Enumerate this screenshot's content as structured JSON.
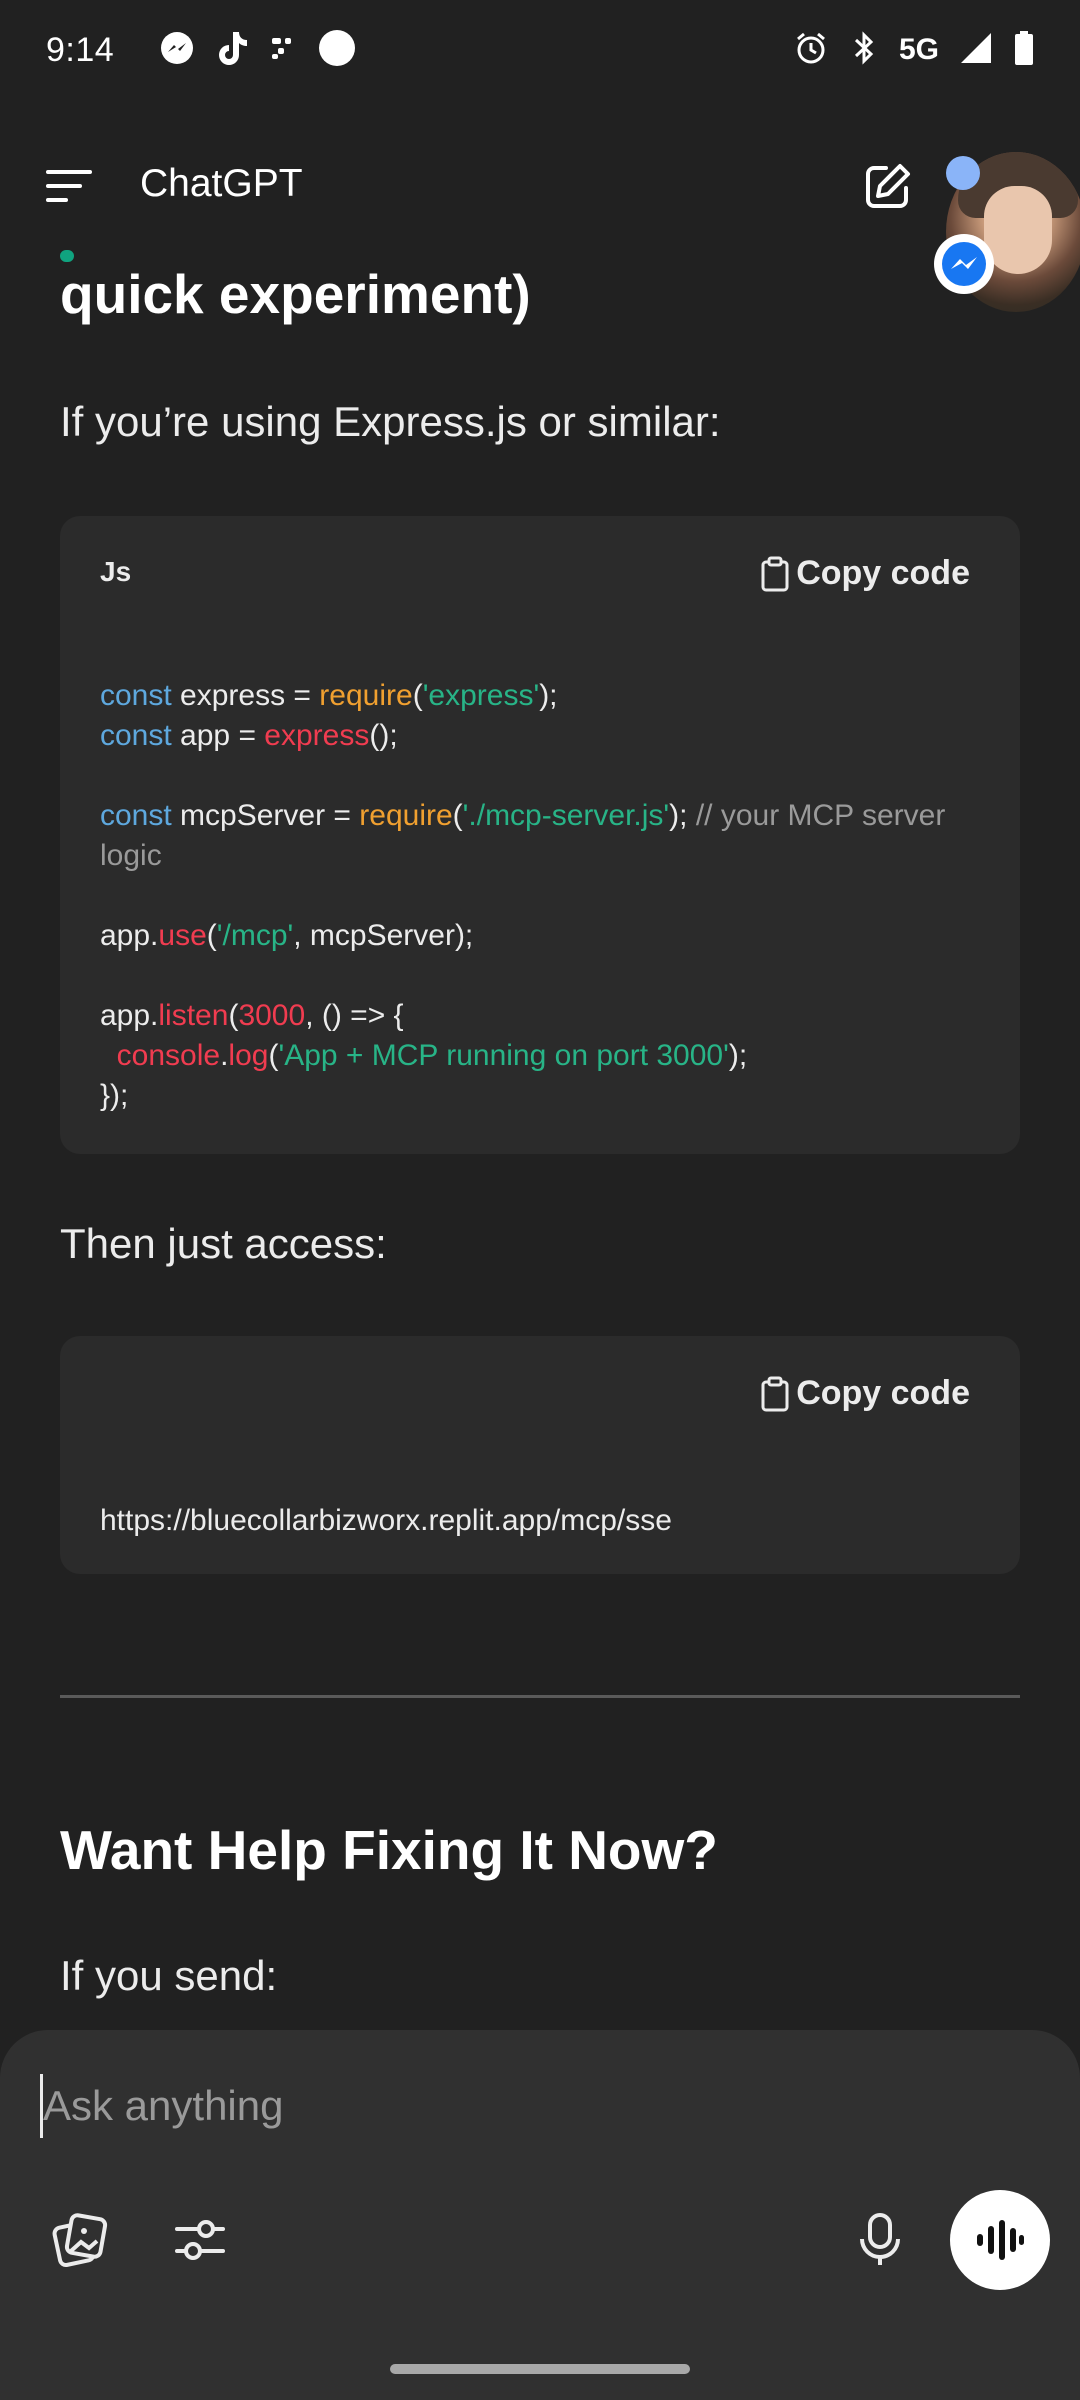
{
  "status_bar": {
    "time": "9:14",
    "network": "5G",
    "left_icons": [
      "messenger-icon",
      "tiktok-icon",
      "slack-like-icon",
      "circle-icon"
    ],
    "right_icons": [
      "alarm-icon",
      "bluetooth-icon",
      "signal-icon",
      "battery-icon"
    ]
  },
  "app_bar": {
    "title": "ChatGPT"
  },
  "content": {
    "partial_heading": "quick experiment)",
    "intro_text": "If you’re using Express.js or similar:",
    "code_block_1": {
      "language": "Js",
      "copy_label": "Copy code"
    },
    "then_text": "Then just access:",
    "code_block_2": {
      "copy_label": "Copy code",
      "url": "https://bluecollarbizworx.replit.app/mcp/sse"
    },
    "section_heading": "Want Help Fixing It Now?",
    "if_send_text": "If you send:"
  },
  "composer": {
    "placeholder": "Ask anything"
  },
  "colors": {
    "background": "#212121",
    "code_bg": "#2b2b2b",
    "composer_bg": "#303030",
    "keyword": "#5ea8de",
    "function": "#f0a030",
    "string": "#28b487",
    "accent_red": "#f03c50",
    "comment": "#9a9a9a"
  }
}
